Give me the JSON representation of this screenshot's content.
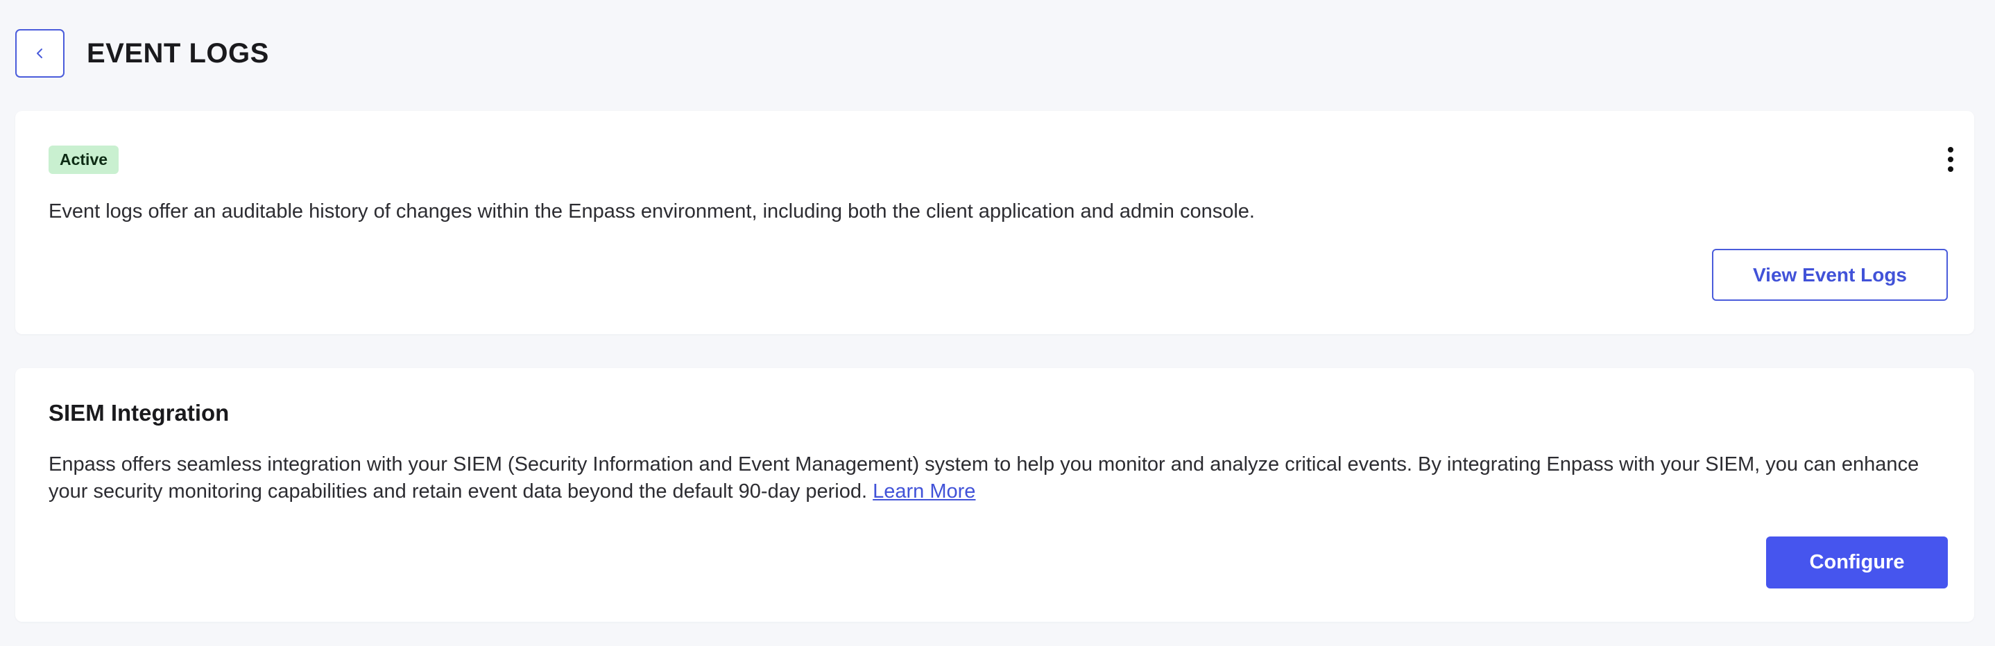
{
  "header": {
    "title": "EVENT LOGS",
    "back_icon": "chevron-left-icon"
  },
  "event_logs_card": {
    "status": "Active",
    "menu_icon": "more-vertical-icon",
    "description": "Event logs offer an auditable history of changes within the Enpass environment, including both the client application and admin console.",
    "view_button_label": "View Event Logs"
  },
  "siem_card": {
    "title": "SIEM Integration",
    "description": "Enpass offers seamless integration with your SIEM (Security Information and Event Management) system to help you monitor and analyze critical events. By integrating Enpass with your SIEM, you can enhance your security monitoring capabilities and retain event data beyond the default 90-day period.",
    "learn_more_label": "Learn More",
    "configure_button_label": "Configure"
  },
  "colors": {
    "accent": "#4655ee",
    "accent_text": "#4152d8",
    "badge_bg": "#c9f0d0",
    "page_bg": "#f6f7fa"
  }
}
